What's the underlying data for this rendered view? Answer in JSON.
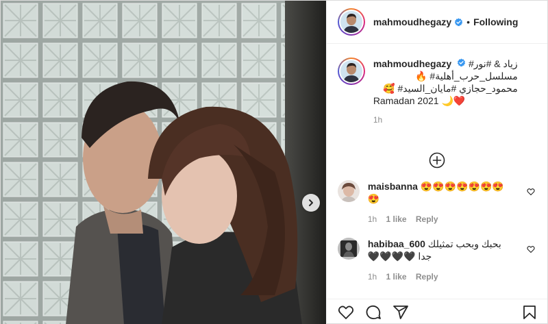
{
  "post": {
    "username": "mahmoudhegazy",
    "follow_separator": "•",
    "follow_status": "Following"
  },
  "caption": {
    "username": "mahmoudhegazy",
    "line1": "زياد & #نور#",
    "line2": "مسلسل_حرب_أهلية# 🔥",
    "line3": "محمود_حجازي #مايان_السيد# 🥰",
    "line4": "Ramadan 2021 🌙❤️",
    "time": "1h"
  },
  "comments": [
    {
      "username": "maisbanna",
      "text": "😍😍😍😍😍😍😍",
      "text2": "😍",
      "time": "1h",
      "likes": "1 like",
      "reply": "Reply"
    },
    {
      "username": "habibaa_600",
      "text": "بحبك وبحب تمثيلك",
      "text2": "جدا 🖤🖤🖤🖤",
      "time": "1h",
      "likes": "1 like",
      "reply": "Reply"
    }
  ],
  "icons": {
    "verified": "verified-badge-icon",
    "next": "chevron-right-icon",
    "load_more": "plus-circle-icon",
    "like": "heart-outline-icon",
    "comment": "comment-bubble-icon",
    "share": "paper-plane-icon",
    "save": "bookmark-icon"
  },
  "colors": {
    "verified": "#3897f0",
    "text": "#262626",
    "muted": "#8e8e8e"
  }
}
